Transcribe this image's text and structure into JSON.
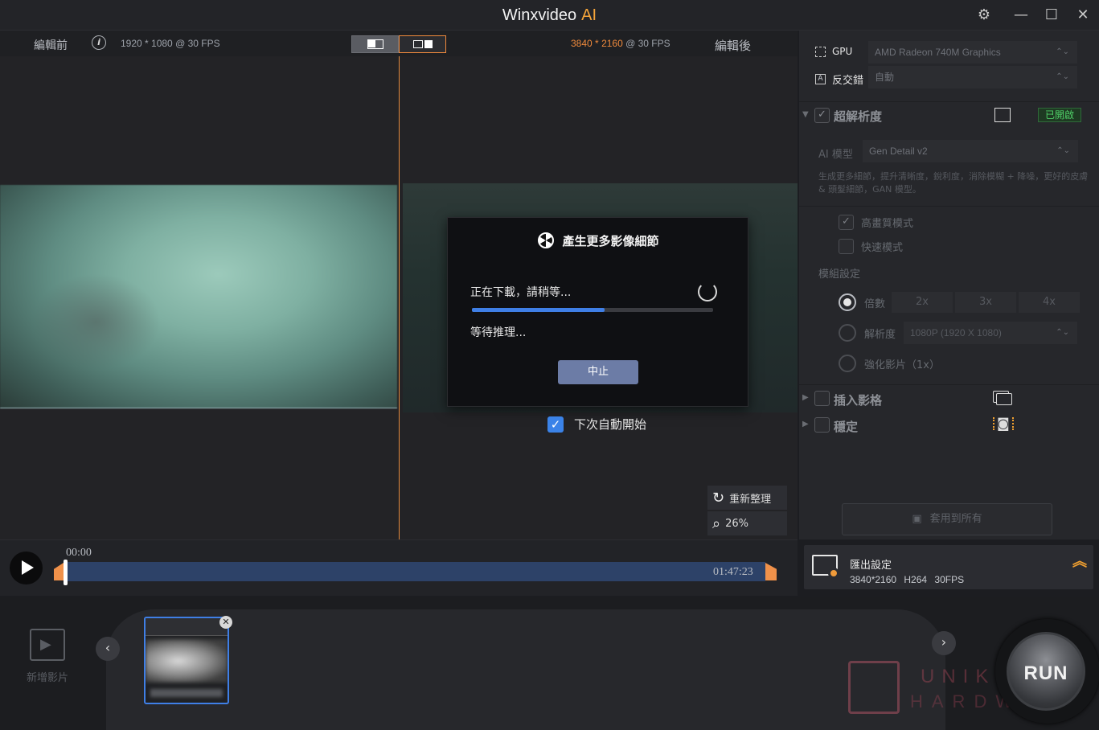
{
  "titlebar": {
    "app_name": "Winxvideo",
    "ai_label": "AI",
    "icons": [
      "gear-icon",
      "minimize-icon",
      "maximize-icon",
      "close-icon"
    ]
  },
  "preview": {
    "before_label": "編輯前",
    "before_res": "1920 * 1080 @ 30 FPS",
    "after_res_w": "3840",
    "after_res_h": "2160",
    "after_fps": "@ 30 FPS",
    "after_label": "編輯後",
    "refresh_label": "重新整理",
    "zoom_label": "26%"
  },
  "dialog": {
    "title": "產生更多影像細節",
    "downloading": "正在下載，請稍等...",
    "progress": 0.55,
    "waiting": "等待推理...",
    "stop_label": "中止"
  },
  "auto_start": {
    "label": "下次自動開始",
    "checked": true
  },
  "timeline": {
    "start": "00:00",
    "end": "01:47:23"
  },
  "panel": {
    "gpu_label": "GPU",
    "gpu_value": "AMD Radeon 740M Graphics",
    "deinterlace_label": "反交錯",
    "deinterlace_value": "自動",
    "super_res_label": "超解析度",
    "super_res_badge": "已開啟",
    "model_label": "AI 模型",
    "model_value": "Gen Detail v2",
    "model_desc": "生成更多細節，提升清晰度，銳利度，消除模糊 + 降噪，更好的皮膚 & 頭髮細節，GAN 模型。",
    "hq_mode": "高畫質模式",
    "fast_mode": "快速模式",
    "module_settings": "模組設定",
    "scale_label": "倍數",
    "scale_options": [
      "2x",
      "3x",
      "4x"
    ],
    "resolution_label": "解析度",
    "resolution_value": "1080P (1920 X 1080)",
    "enhance_label": "強化影片（1x）",
    "interp_label": "插入影格",
    "stabilize_label": "穩定",
    "apply_all": "套用到所有"
  },
  "export": {
    "title": "匯出設定",
    "summary": "3840*2160  H264  30FPS"
  },
  "bottom": {
    "add_video": "新增影片",
    "run_label": "RUN",
    "watermark1": "UNIKO",
    "watermark2": "HARDWARE"
  },
  "colors": {
    "accent_orange": "#f08a3c",
    "progress_blue": "#3f7fe6",
    "badge_green": "#4fd068"
  }
}
